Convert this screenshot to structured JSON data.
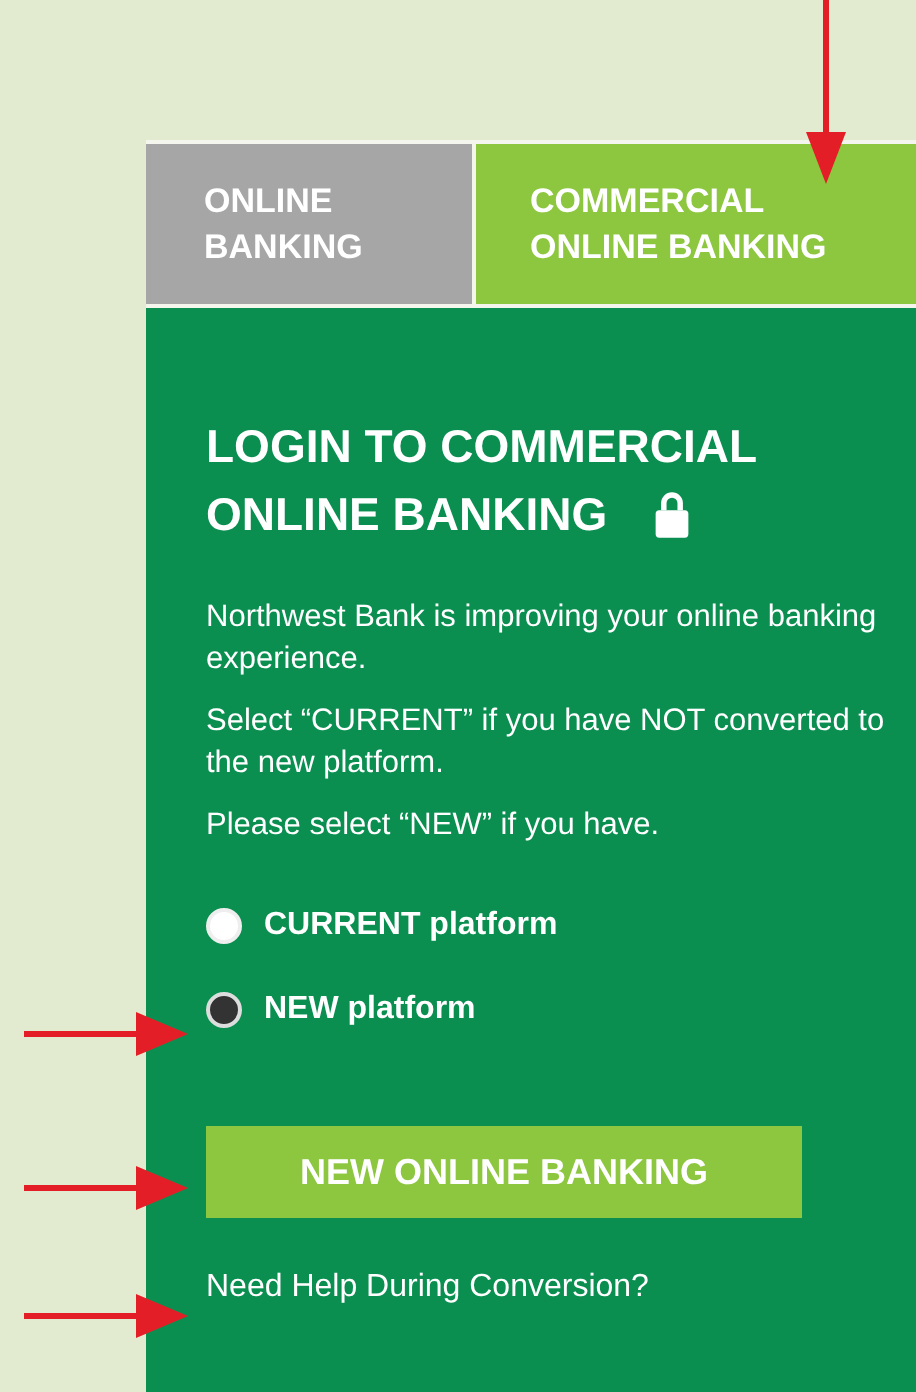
{
  "tabs": [
    {
      "label": "ONLINE BANKING",
      "selected": false
    },
    {
      "label": "COMMERCIAL ONLINE BANKING",
      "selected": true
    }
  ],
  "login": {
    "title_lines": [
      "LOGIN TO COMMERCIAL",
      "ONLINE BANKING"
    ],
    "paragraphs": [
      "Northwest Bank is improving your online banking experience.",
      "Select “CURRENT” if you have NOT converted to the new platform.",
      "Please select “NEW” if you have."
    ],
    "options": [
      {
        "label": "CURRENT platform",
        "selected": false
      },
      {
        "label": "NEW platform",
        "selected": true
      }
    ],
    "button": "NEW ONLINE BANKING",
    "help_link": "Need Help During Conversion?"
  }
}
